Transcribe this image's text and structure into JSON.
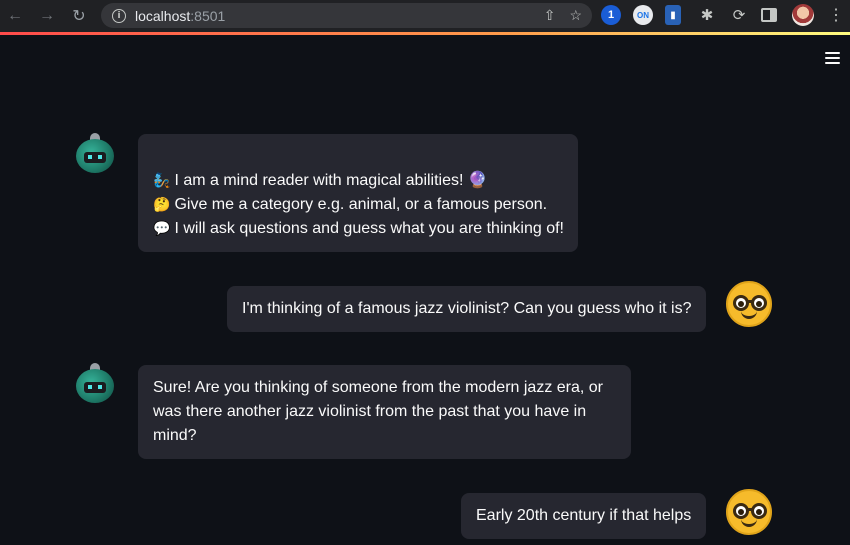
{
  "browser": {
    "url_host": "localhost",
    "url_port": ":8501"
  },
  "messages": [
    {
      "role": "assistant",
      "lines": [
        {
          "emoji": "🧞",
          "text": "I am a mind reader with magical abilities! 🔮"
        },
        {
          "emoji": "🤔",
          "text": "Give me a category e.g. animal, or a famous person."
        },
        {
          "emoji": "💬",
          "text": "I will ask questions and guess what you are thinking of!"
        }
      ]
    },
    {
      "role": "user",
      "text": "I'm thinking of a famous jazz violinist? Can you guess who it is?"
    },
    {
      "role": "assistant",
      "lines": [
        {
          "text": "Sure! Are you thinking of someone from the modern jazz era, or"
        },
        {
          "text": "was there another jazz violinist from the past that you have in"
        },
        {
          "text": "mind?"
        }
      ]
    },
    {
      "role": "user",
      "text": "Early 20th century if that helps"
    }
  ]
}
